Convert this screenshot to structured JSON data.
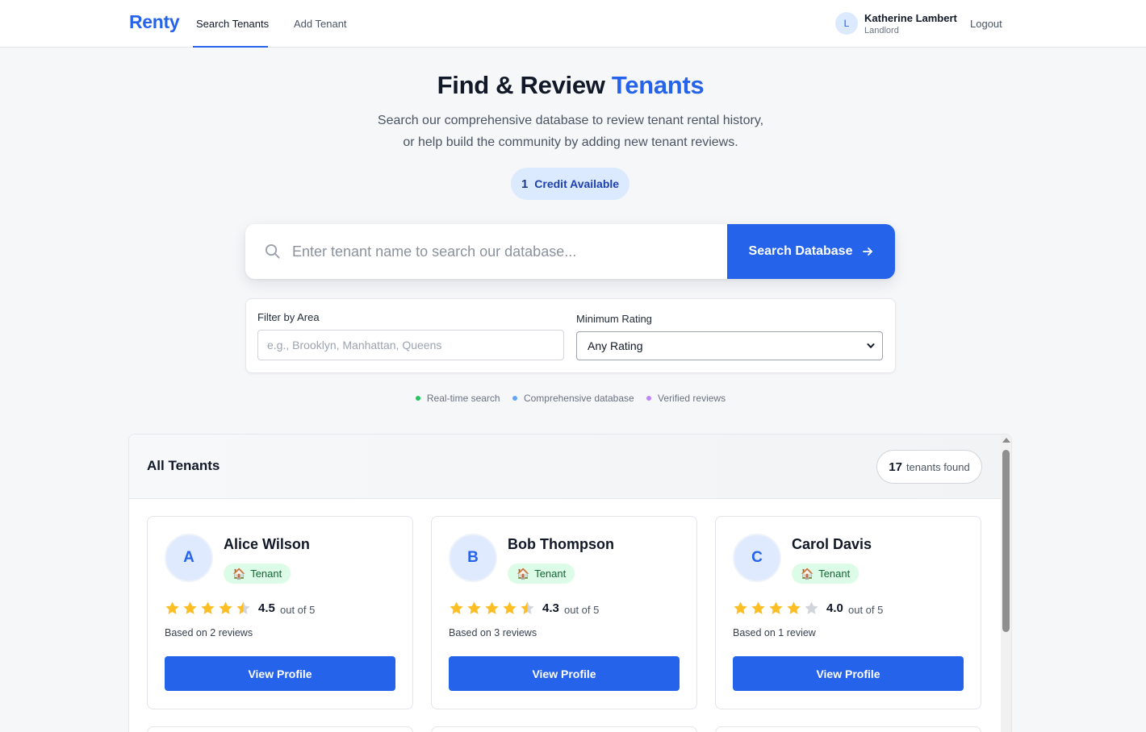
{
  "nav": {
    "logo": "Renty",
    "tabs": [
      {
        "label": "Search Tenants",
        "active": true
      },
      {
        "label": "Add Tenant",
        "active": false
      }
    ],
    "user": {
      "initial": "L",
      "name": "Katherine Lambert",
      "role": "Landlord"
    },
    "logout": "Logout"
  },
  "hero": {
    "title_main": "Find & Review ",
    "title_accent": "Tenants",
    "subtitle_line1": "Search our comprehensive database to review tenant rental history,",
    "subtitle_line2": "or help build the community by adding new tenant reviews.",
    "credit_count": "1",
    "credit_label": "Credit Available"
  },
  "search": {
    "placeholder": "Enter tenant name to search our database...",
    "value": "",
    "button_label": "Search Database"
  },
  "filters": {
    "area_label": "Filter by Area",
    "area_placeholder": "e.g., Brooklyn, Manhattan, Queens",
    "rating_label": "Minimum Rating",
    "rating_selected": "Any Rating"
  },
  "features": [
    {
      "label": "Real-time search",
      "color": "#22c55e"
    },
    {
      "label": "Comprehensive database",
      "color": "#60a5fa"
    },
    {
      "label": "Verified reviews",
      "color": "#c084fc"
    }
  ],
  "results": {
    "title": "All Tenants",
    "count": "17",
    "count_suffix": "tenants found",
    "tenants": [
      {
        "initial": "A",
        "name": "Alice Wilson",
        "badge_icon": "house-icon",
        "badge": "Tenant",
        "rating": 4.5,
        "rating_text": "4.5",
        "out_of": "out of 5",
        "reviews": "Based on 2 reviews",
        "button": "View Profile"
      },
      {
        "initial": "B",
        "name": "Bob Thompson",
        "badge_icon": "house-icon",
        "badge": "Tenant",
        "rating": 4.3,
        "rating_text": "4.3",
        "out_of": "out of 5",
        "reviews": "Based on 3 reviews",
        "button": "View Profile"
      },
      {
        "initial": "C",
        "name": "Carol Davis",
        "badge_icon": "house-icon",
        "badge": "Tenant",
        "rating": 4.0,
        "rating_text": "4.0",
        "out_of": "out of 5",
        "reviews": "Based on 1 review",
        "button": "View Profile"
      }
    ]
  },
  "colors": {
    "primary": "#2563eb",
    "star": "#fbbf24",
    "star_empty": "#d1d5db"
  }
}
